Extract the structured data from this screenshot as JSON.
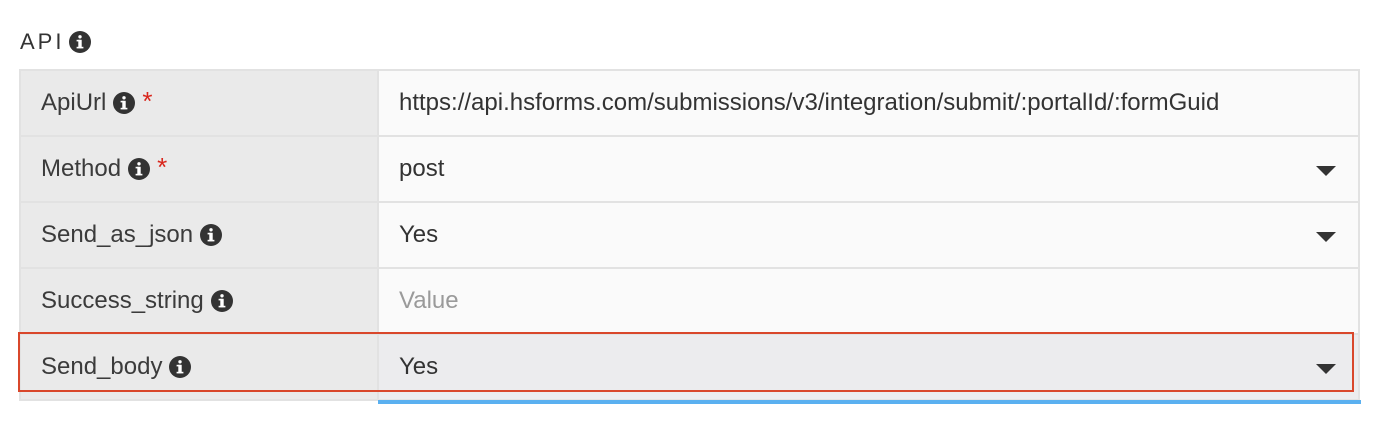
{
  "section": {
    "title": "API"
  },
  "fields": [
    {
      "label": "ApiUrl",
      "required": true,
      "value": "https://api.hsforms.com/submissions/v3/integration/submit/:portalId/:formGuid",
      "placeholder": "",
      "type": "text"
    },
    {
      "label": "Method",
      "required": true,
      "value": "post",
      "placeholder": "",
      "type": "select"
    },
    {
      "label": "Send_as_json",
      "required": false,
      "value": "Yes",
      "placeholder": "",
      "type": "select"
    },
    {
      "label": "Success_string",
      "required": false,
      "value": "",
      "placeholder": "Value",
      "type": "text"
    },
    {
      "label": "Send_body",
      "required": false,
      "value": "Yes",
      "placeholder": "",
      "type": "select"
    }
  ],
  "required_marker": "*",
  "icons": {
    "info": "info-circle-icon",
    "dropdown": "caret-down-icon"
  },
  "colors": {
    "highlight_border": "#d9472b",
    "focus_underline": "#5ab0f0",
    "required": "#d9261c"
  }
}
